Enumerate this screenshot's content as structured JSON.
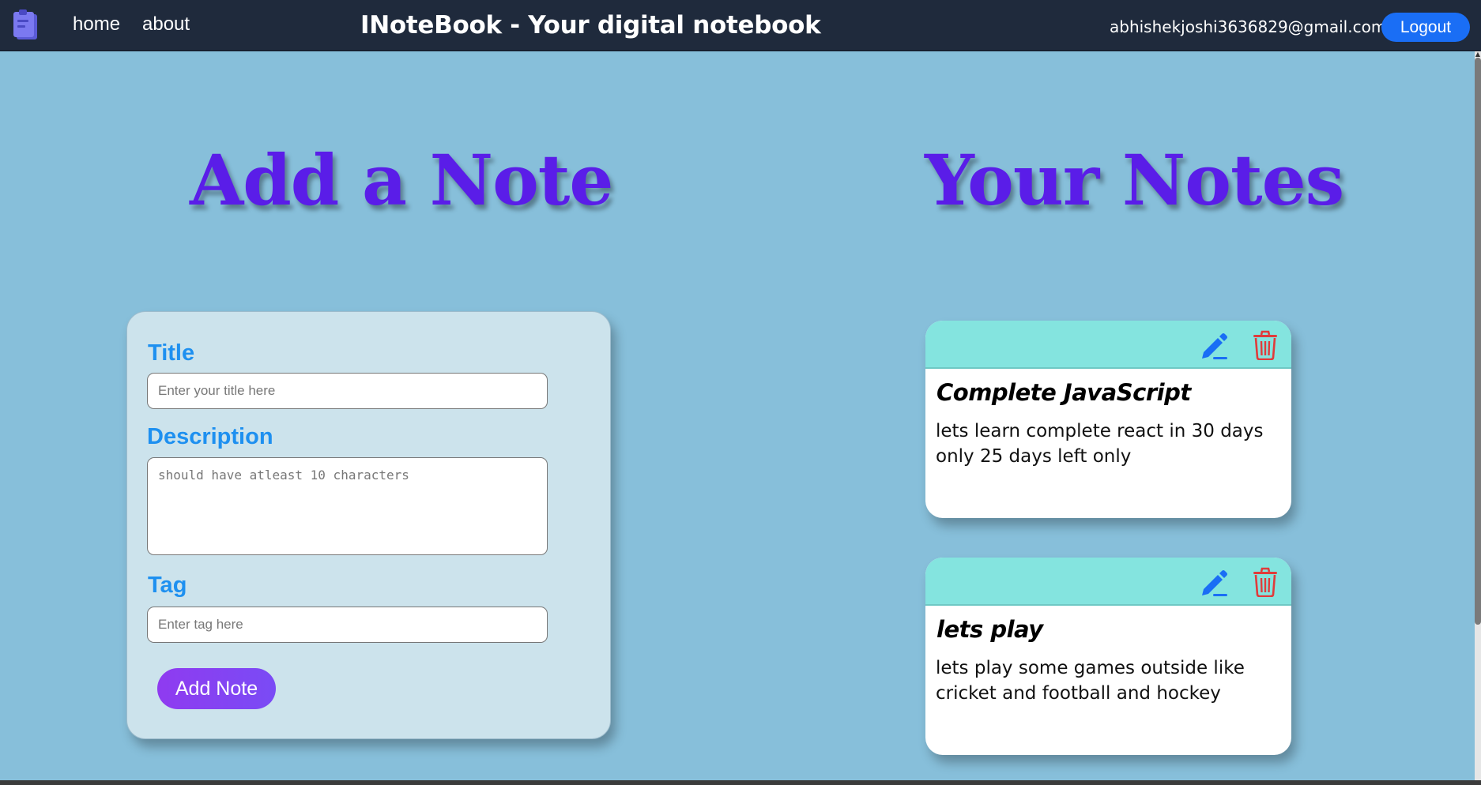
{
  "navbar": {
    "logo_icon": "notebook-icon",
    "links": {
      "home": "home",
      "about": "about"
    },
    "brand": "INoteBook - Your digital notebook",
    "user_email": "abhishekjoshi3636829@gmail.com",
    "logout_label": "Logout",
    "background": "#1f2a3c",
    "logout_color": "#1a6ef5"
  },
  "add_section": {
    "heading": "Add a Note",
    "heading_color": "#5a1de8",
    "form": {
      "title_label": "Title",
      "title_placeholder": "Enter your title here",
      "title_value": "",
      "description_label": "Description",
      "description_placeholder": "should have atleast 10 characters",
      "description_value": "",
      "tag_label": "Tag",
      "tag_placeholder": "Enter tag here",
      "tag_value": "",
      "submit_label": "Add Note"
    }
  },
  "notes_section": {
    "heading": "Your Notes",
    "notes": [
      {
        "title": "Complete JavaScript",
        "description": "lets learn complete react in 30 days only 25 days left only",
        "edit_icon": "pencil-icon",
        "delete_icon": "trash-icon"
      },
      {
        "title": "lets play",
        "description": "lets play some games outside like cricket and football and hockey",
        "edit_icon": "pencil-icon",
        "delete_icon": "trash-icon"
      }
    ]
  },
  "colors": {
    "page_background": "#87bfda",
    "card_header": "#84e4df",
    "label_blue": "#1e90f0",
    "edit_blue": "#1a6ef5",
    "delete_red": "#e03b3b"
  }
}
